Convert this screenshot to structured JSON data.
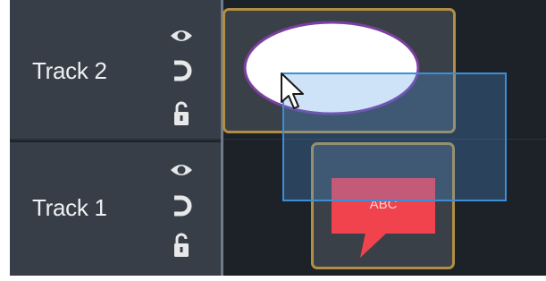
{
  "tracks": [
    {
      "label": "Track 2",
      "icons": [
        "eye-icon",
        "magnet-icon",
        "lock-open-icon"
      ]
    },
    {
      "label": "Track 1",
      "icons": [
        "eye-icon",
        "magnet-icon",
        "lock-open-icon"
      ]
    }
  ],
  "clips": {
    "ellipse": {
      "shape": "ellipse",
      "fill": "#ffffff",
      "stroke": "#7b3fa0"
    },
    "callout": {
      "shape": "speech-callout",
      "fill": "#f0434d",
      "text": "ABC"
    }
  },
  "colors": {
    "timeline_background": "#1c2228",
    "track_header": "#373e47",
    "clip_border": "#b18e43",
    "selection": "#3c8ed6",
    "callout_red": "#f0434d"
  },
  "cursor": {
    "type": "arrow-pointer"
  }
}
